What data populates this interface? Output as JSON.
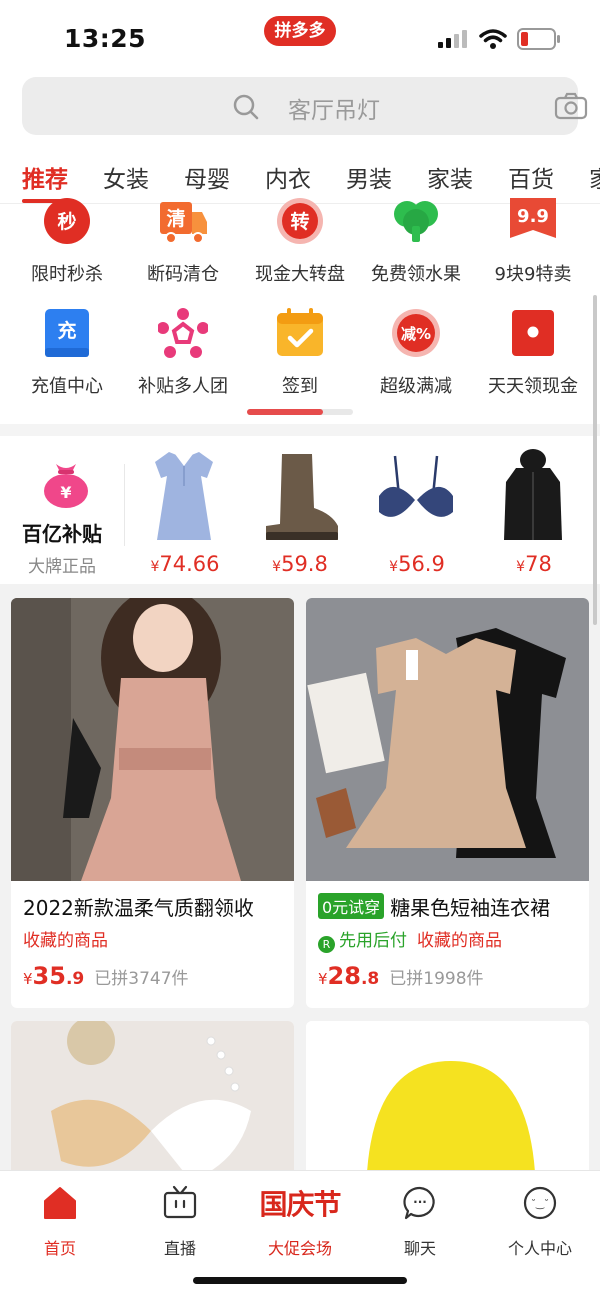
{
  "status_bar": {
    "time": "13:25",
    "brand_badge": "拼多多",
    "battery_color": "#e02e24"
  },
  "search": {
    "placeholder": "客厅吊灯",
    "icon_left": "search-icon",
    "icon_right": "camera-icon"
  },
  "tabs": [
    {
      "label": "推荐",
      "active": true
    },
    {
      "label": "女装"
    },
    {
      "label": "母婴"
    },
    {
      "label": "内衣"
    },
    {
      "label": "男装"
    },
    {
      "label": "家装"
    },
    {
      "label": "百货"
    },
    {
      "label": "家"
    }
  ],
  "quick_grid": {
    "row1": [
      {
        "label": "限时秒杀",
        "icon": "flash-sale-icon",
        "glyph": "秒"
      },
      {
        "label": "断码清仓",
        "icon": "clearance-truck-icon",
        "glyph": "清"
      },
      {
        "label": "现金大转盘",
        "icon": "spin-wheel-icon",
        "glyph": "转"
      },
      {
        "label": "免费领水果",
        "icon": "fruit-tree-icon"
      },
      {
        "label": "9块9特卖",
        "icon": "nine-nine-icon",
        "glyph": "9.9"
      }
    ],
    "row2": [
      {
        "label": "充值中心",
        "icon": "recharge-icon",
        "glyph": "充"
      },
      {
        "label": "补贴多人团",
        "icon": "group-subsidy-icon"
      },
      {
        "label": "签到",
        "icon": "calendar-check-icon"
      },
      {
        "label": "超级满减",
        "icon": "discount-icon",
        "glyph": "减%"
      },
      {
        "label": "天天领现金",
        "icon": "red-envelope-icon"
      }
    ],
    "scroll_progress": 0.72
  },
  "subsidy": {
    "title": "百亿补贴",
    "subtitle": "大牌正品",
    "bag_glyph": "¥",
    "currency": "¥",
    "deals": [
      {
        "price": "74.66",
        "item": "dress"
      },
      {
        "price": "59.8",
        "item": "boot"
      },
      {
        "price": "56.9",
        "item": "bra"
      },
      {
        "price": "78",
        "item": "coat"
      }
    ]
  },
  "products": [
    {
      "title": "2022新款温柔气质翻领收",
      "tag": "收藏的商品",
      "price_int": "35",
      "price_dec": ".9",
      "sold": "已拼3747件"
    },
    {
      "trial_badge": "0元试穿",
      "title": "糖果色短袖连衣裙",
      "pay_later": "先用后付",
      "pay_later_glyph": "R",
      "tag": "收藏的商品",
      "price_int": "28",
      "price_dec": ".8",
      "sold": "已拼1998件"
    }
  ],
  "bottom_nav": [
    {
      "label": "首页",
      "icon": "home-icon",
      "active": true
    },
    {
      "label": "直播",
      "icon": "tv-icon"
    },
    {
      "label": "大促会场",
      "banner": "国庆节"
    },
    {
      "label": "聊天",
      "icon": "chat-icon",
      "glyph": "···"
    },
    {
      "label": "个人中心",
      "icon": "profile-icon",
      "glyph": "˘‿˘"
    }
  ],
  "colors": {
    "accent": "#e02e24",
    "green": "#2aa32a"
  }
}
